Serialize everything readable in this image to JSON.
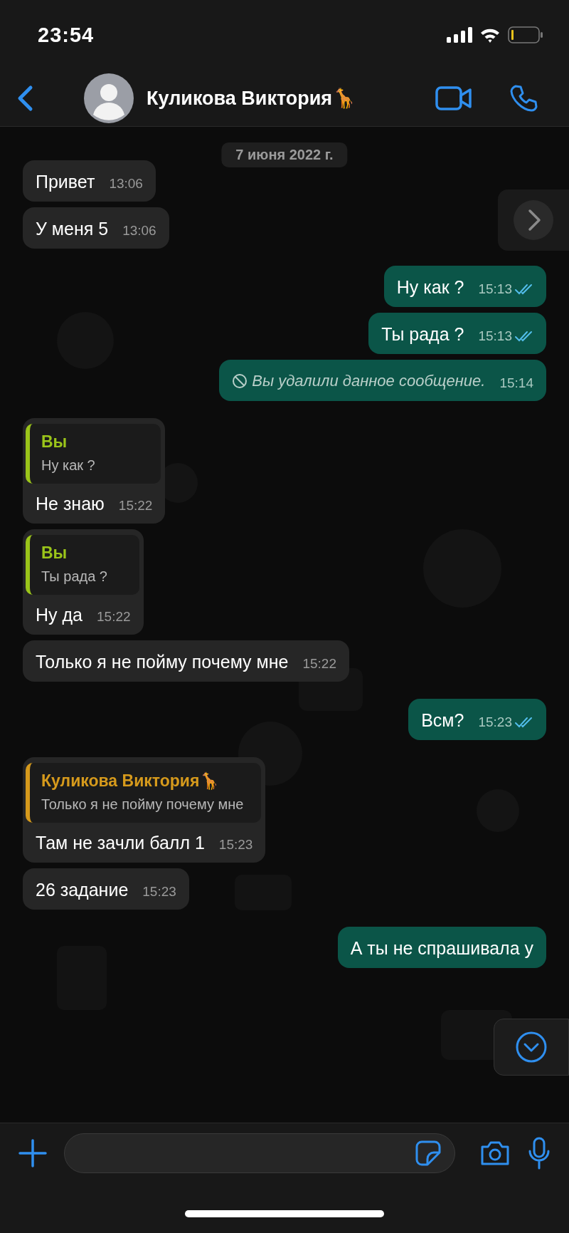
{
  "status_bar": {
    "time": "23:54"
  },
  "header": {
    "contact_name": "Куликова Виктория🦒"
  },
  "chat": {
    "date": "7 июня 2022 г.",
    "messages": [
      {
        "kind": "incoming",
        "text": "Привет",
        "time": "13:06"
      },
      {
        "kind": "incoming",
        "text": "У меня 5",
        "time": "13:06"
      },
      {
        "kind": "outgoing",
        "text": "Ну как ?",
        "time": "15:13",
        "read": true
      },
      {
        "kind": "outgoing",
        "text": "Ты рада ?",
        "time": "15:13",
        "read": true
      },
      {
        "kind": "deleted",
        "text": "Вы удалили данное сообщение.",
        "time": "15:14"
      },
      {
        "kind": "incoming",
        "quote": {
          "author": "Вы",
          "text": "Ну как ?",
          "color": "#9bc51a"
        },
        "text": "Не знаю",
        "time": "15:22"
      },
      {
        "kind": "incoming",
        "quote": {
          "author": "Вы",
          "text": "Ты рада ?",
          "color": "#9bc51a"
        },
        "text": "Ну да",
        "time": "15:22"
      },
      {
        "kind": "incoming",
        "text": "Только я не пойму почему мне",
        "time": "15:22"
      },
      {
        "kind": "outgoing",
        "text": "Всм?",
        "time": "15:23",
        "read": true
      },
      {
        "kind": "incoming",
        "quote": {
          "author": "Куликова Виктория🦒",
          "text": "Только я не пойму почему мне",
          "color": "#d69a1c"
        },
        "text": "Там не зачли балл  1",
        "time": "15:23"
      },
      {
        "kind": "incoming",
        "text": "26 задание",
        "time": "15:23"
      },
      {
        "kind": "outgoing",
        "text": "А ты не спрашивала у"
      }
    ]
  }
}
